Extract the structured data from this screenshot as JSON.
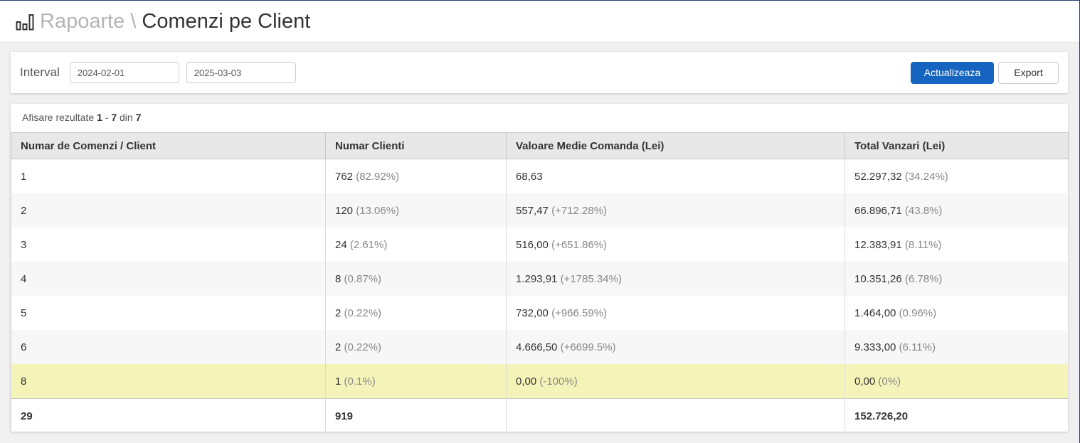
{
  "header": {
    "breadcrumb_parent": "Rapoarte",
    "separator": "\\",
    "page_title": "Comenzi pe Client",
    "icon": "bar-chart-icon"
  },
  "filters": {
    "label": "Interval",
    "date_from": "2024-02-01",
    "date_to": "2025-03-03",
    "update_button": "Actualizeaza",
    "export_button": "Export"
  },
  "results": {
    "summary_prefix": "Afisare rezultate",
    "from": "1",
    "dash": "-",
    "to": "7",
    "of_word": "din",
    "total": "7"
  },
  "table": {
    "columns": [
      "Numar de Comenzi / Client",
      "Numar Clienti",
      "Valoare Medie Comanda (Lei)",
      "Total Vanzari (Lei)"
    ],
    "rows": [
      {
        "orders": "1",
        "clients": "762",
        "clients_pct": "(82.92%)",
        "avg": "68,63",
        "avg_pct": "",
        "sales": "52.297,32",
        "sales_pct": "(34.24%)"
      },
      {
        "orders": "2",
        "clients": "120",
        "clients_pct": "(13.06%)",
        "avg": "557,47",
        "avg_pct": "(+712.28%)",
        "sales": "66.896,71",
        "sales_pct": "(43.8%)"
      },
      {
        "orders": "3",
        "clients": "24",
        "clients_pct": "(2.61%)",
        "avg": "516,00",
        "avg_pct": "(+651.86%)",
        "sales": "12.383,91",
        "sales_pct": "(8.11%)"
      },
      {
        "orders": "4",
        "clients": "8",
        "clients_pct": "(0.87%)",
        "avg": "1.293,91",
        "avg_pct": "(+1785.34%)",
        "sales": "10.351,26",
        "sales_pct": "(6.78%)"
      },
      {
        "orders": "5",
        "clients": "2",
        "clients_pct": "(0.22%)",
        "avg": "732,00",
        "avg_pct": "(+966.59%)",
        "sales": "1.464,00",
        "sales_pct": "(0.96%)"
      },
      {
        "orders": "6",
        "clients": "2",
        "clients_pct": "(0.22%)",
        "avg": "4.666,50",
        "avg_pct": "(+6699.5%)",
        "sales": "9.333,00",
        "sales_pct": "(6.11%)"
      },
      {
        "orders": "8",
        "clients": "1",
        "clients_pct": "(0.1%)",
        "avg": "0,00",
        "avg_pct": "(-100%)",
        "sales": "0,00",
        "sales_pct": "(0%)",
        "highlighted": true
      }
    ],
    "totals": {
      "orders": "29",
      "clients": "919",
      "avg": "",
      "sales": "152.726,20"
    }
  },
  "colors": {
    "primary": "#1565c0",
    "highlight_row": "#f5f4b8",
    "header_bg": "#e8e8e8"
  }
}
